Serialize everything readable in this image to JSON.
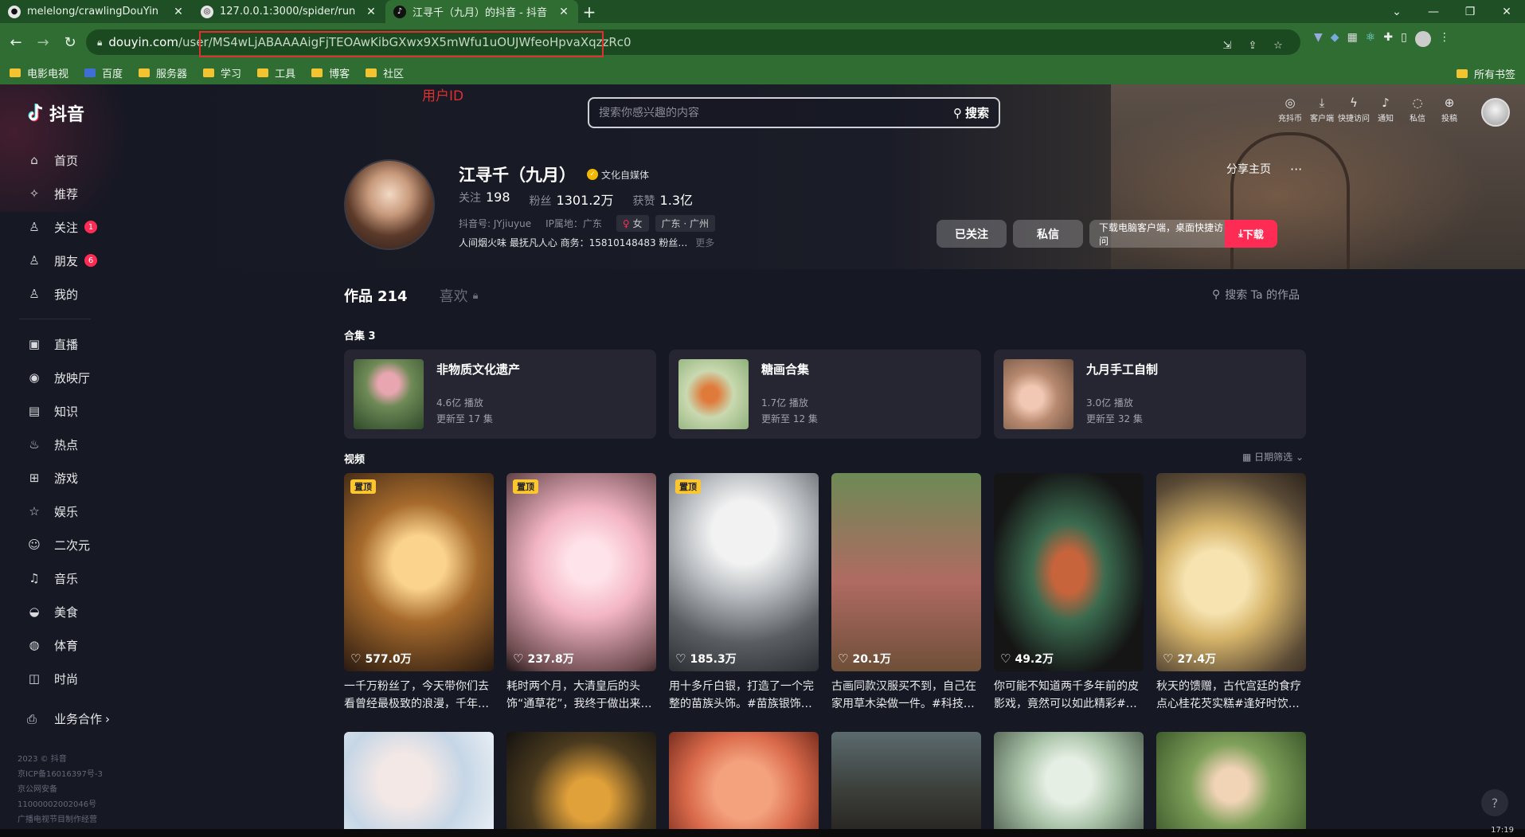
{
  "browser": {
    "tabs": [
      {
        "label": "melelong/crawlingDouYin",
        "icon": "github-icon"
      },
      {
        "label": "127.0.0.1:3000/spider/run",
        "icon": "globe-icon"
      },
      {
        "label": "江寻千（九月）的抖音 - 抖音",
        "icon": "douyin-icon"
      }
    ],
    "url_host": "douyin.com",
    "url_path": "/user/MS4wLjABAAAAigFjTEOAwKibGXwx9X5mWfu1uOUJWfeoHpvaXqzzRc0",
    "bookmarks": [
      "电影电视",
      "百度",
      "服务器",
      "学习",
      "工具",
      "博客",
      "社区"
    ],
    "bookmarks_right": "所有书签"
  },
  "annotation": {
    "uid_label": "用户ID",
    "color": "#e02f2f"
  },
  "sidebar": {
    "logo": "抖音",
    "items": [
      {
        "label": "首页",
        "icon": "home-icon"
      },
      {
        "label": "推荐",
        "icon": "sparkle-icon"
      },
      {
        "label": "关注",
        "icon": "follow-icon",
        "badge": "1"
      },
      {
        "label": "朋友",
        "icon": "friends-icon",
        "badge": "6"
      },
      {
        "label": "我的",
        "icon": "person-icon"
      }
    ],
    "items2": [
      {
        "label": "直播",
        "icon": "tv-icon"
      },
      {
        "label": "放映厅",
        "icon": "film-icon"
      },
      {
        "label": "知识",
        "icon": "book-icon"
      },
      {
        "label": "热点",
        "icon": "flame-icon"
      },
      {
        "label": "游戏",
        "icon": "gamepad-icon"
      },
      {
        "label": "娱乐",
        "icon": "star-icon"
      },
      {
        "label": "二次元",
        "icon": "anime-icon"
      },
      {
        "label": "音乐",
        "icon": "music-icon"
      },
      {
        "label": "美食",
        "icon": "food-icon"
      },
      {
        "label": "体育",
        "icon": "ball-icon"
      },
      {
        "label": "时尚",
        "icon": "bag-icon"
      }
    ],
    "business": "业务合作",
    "footer": [
      "2023 © 抖音",
      "京ICP备16016397号-3",
      "京公网安备",
      "11000002002046号",
      "广播电视节目制作经营"
    ]
  },
  "header": {
    "search_placeholder": "搜索你感兴趣的内容",
    "search_button": "搜索",
    "icons": [
      {
        "label": "充抖币",
        "icon": "coin-icon"
      },
      {
        "label": "客户端",
        "icon": "download-icon"
      },
      {
        "label": "快捷访问",
        "icon": "bolt-icon"
      },
      {
        "label": "通知",
        "icon": "bell-icon"
      },
      {
        "label": "私信",
        "icon": "chat-icon"
      },
      {
        "label": "投稿",
        "icon": "upload-icon"
      }
    ]
  },
  "profile": {
    "name": "江寻千（九月）",
    "verify": "文化自媒体",
    "following_label": "关注",
    "following": "198",
    "fans_label": "粉丝",
    "fans": "1301.2万",
    "likes_label": "获赞",
    "likes": "1.3亿",
    "douyin_id": "抖音号: JYjiuyue",
    "ip": "IP属地：广东",
    "gender_tag": "女",
    "location_tag": "广东 · 广州",
    "bio": "人间烟火味 最抚凡人心 商务：15810148483 粉丝…",
    "bio_more": "更多",
    "share": "分享主页",
    "more": "···",
    "btn_follow": "已关注",
    "btn_msg": "私信",
    "download_text": "下载电脑客户端，桌面快捷访问",
    "download_btn": "下载"
  },
  "tabs": {
    "works_label": "作品",
    "works_count": "214",
    "likes_label": "喜欢",
    "search_works": "搜索 Ta 的作品"
  },
  "collections": {
    "title": "合集 3",
    "items": [
      {
        "title": "非物质文化遗产",
        "plays": "4.6亿 播放",
        "updated": "更新至 17 集"
      },
      {
        "title": "糖画合集",
        "plays": "1.7亿 播放",
        "updated": "更新至 12 集"
      },
      {
        "title": "九月手工自制",
        "plays": "3.0亿 播放",
        "updated": "更新至 32 集"
      }
    ]
  },
  "videos": {
    "title": "视频",
    "date_filter": "日期筛选",
    "pin_label": "置顶",
    "items": [
      {
        "likes": "577.0万",
        "desc": "一千万粉丝了，今天带你们去看曾经最极致的浪漫，千年…",
        "pinned": true
      },
      {
        "likes": "237.8万",
        "desc": "耗时两个月，大清皇后的头饰“通草花”，我终于做出来…",
        "pinned": true
      },
      {
        "likes": "185.3万",
        "desc": "用十多斤白银，打造了一个完整的苗族头饰。#苗族银饰…",
        "pinned": true
      },
      {
        "likes": "20.1万",
        "desc": "古画同款汉服买不到，自己在家用草木染做一件。#科技…",
        "pinned": false
      },
      {
        "likes": "49.2万",
        "desc": "你可能不知道两千多年前的皮影戏，竟然可以如此精彩#…",
        "pinned": false
      },
      {
        "likes": "27.4万",
        "desc": "秋天的馈赠，古代宫廷的食疗点心桂花芡实糕#逢好时饮…",
        "pinned": false
      }
    ]
  },
  "statusbar": {
    "time": "17:19"
  }
}
